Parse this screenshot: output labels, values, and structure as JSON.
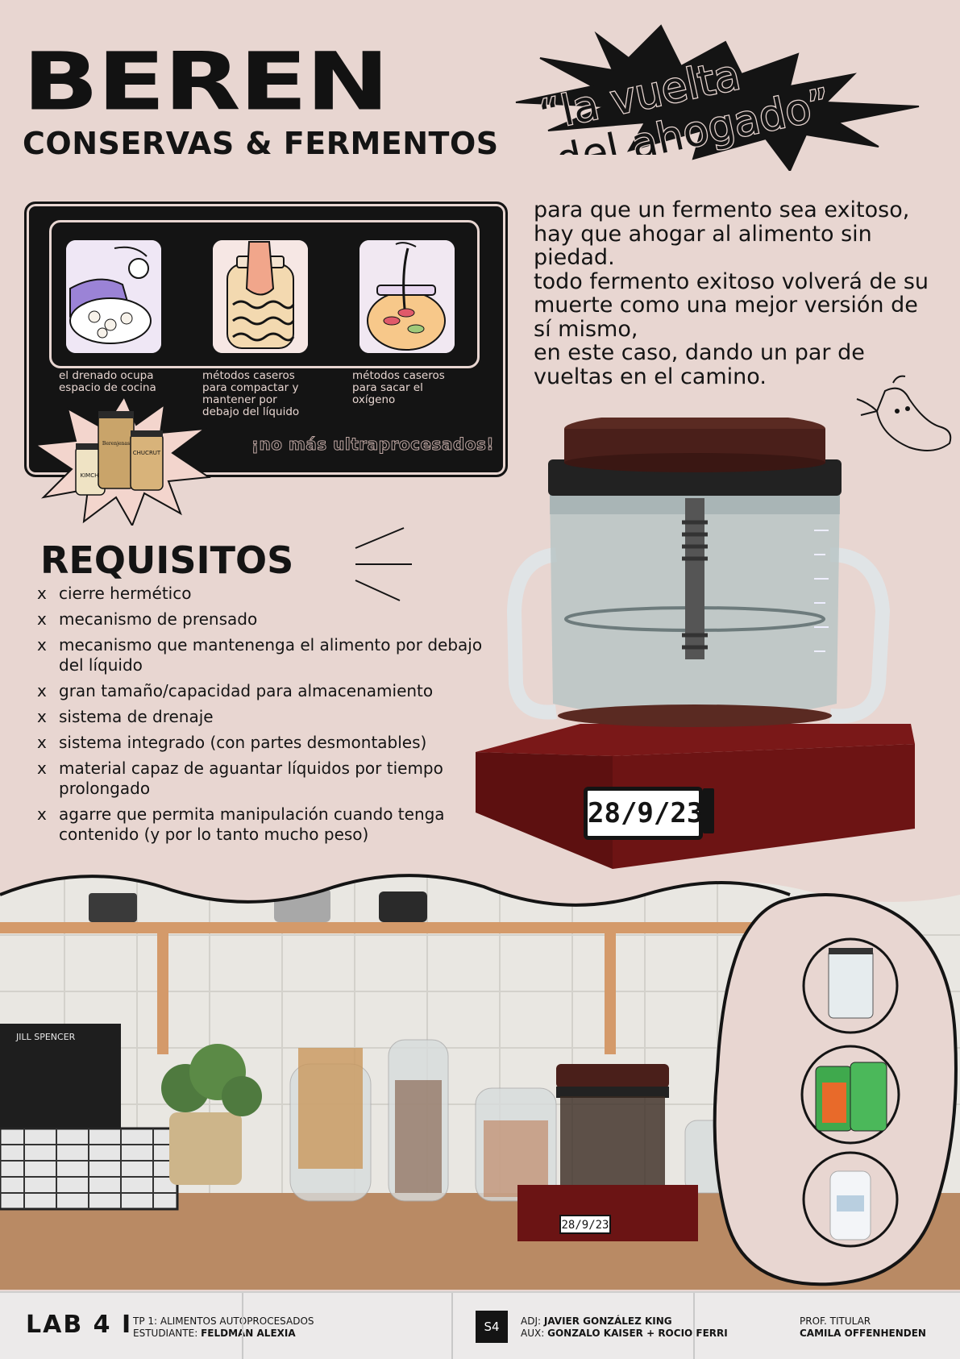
{
  "header": {
    "brand": "BEREN",
    "subtitle": "CONSERVAS & FERMENTOS",
    "tagline_line1": "“la vuelta",
    "tagline_line2": "del ahogado”"
  },
  "panel": {
    "captions": [
      "el drenado ocupa\nespacio de cocina",
      "métodos caseros\npara compactar y\nmantener por\ndebajo del líquido",
      "métodos caseros\npara sacar el\noxígeno"
    ],
    "slogan": "¡no más ultraprocesados!",
    "jar_labels": [
      "KIMCHI",
      "Berenjenas",
      "CHUCRUT"
    ]
  },
  "intro": {
    "p1": "para que un fermento sea exitoso, hay que ahogar al alimento sin piedad.",
    "p2": "todo fermento exitoso volverá de su muerte como una mejor versión de sí mismo,",
    "p3": "en este caso, dando un par de vueltas en el camino."
  },
  "requisitos": {
    "title": "REQUISITOS",
    "mark": "x",
    "items": [
      "cierre hermético",
      "mecanismo de prensado",
      "mecanismo que mantenenga el alimento por debajo del líquido",
      "gran tamaño/capacidad para almacenamiento",
      "sistema de drenaje",
      "sistema integrado (con partes desmontables)",
      "material capaz de aguantar líquidos por tiempo prolongado",
      "agarre que permita manipulación cuando tenga contenido (y por lo tanto mucho peso)"
    ]
  },
  "product": {
    "date": "28/9/23",
    "date_small": "28/9/23"
  },
  "kitchen": {
    "book_author": "JILL SPENCER"
  },
  "footer": {
    "lab": "LAB 4 I",
    "tp": "TP 1: ALIMENTOS AUTOPROCESADOS",
    "student_label": "ESTUDIANTE:",
    "student": "FELDMAN ALEXIA",
    "section": "S4",
    "adj_label": "ADJ:",
    "adj": "JAVIER GONZÁLEZ KING",
    "aux_label": "AUX:",
    "aux": "GONZALO KAISER + ROCIO FERRI",
    "prof_label": "PROF. TITULAR",
    "prof": "CAMILA OFFENHENDEN"
  },
  "colors": {
    "background": "#e8d6d1",
    "ink": "#141414",
    "lid": "#4a1f1a",
    "base": "#6b1414"
  }
}
